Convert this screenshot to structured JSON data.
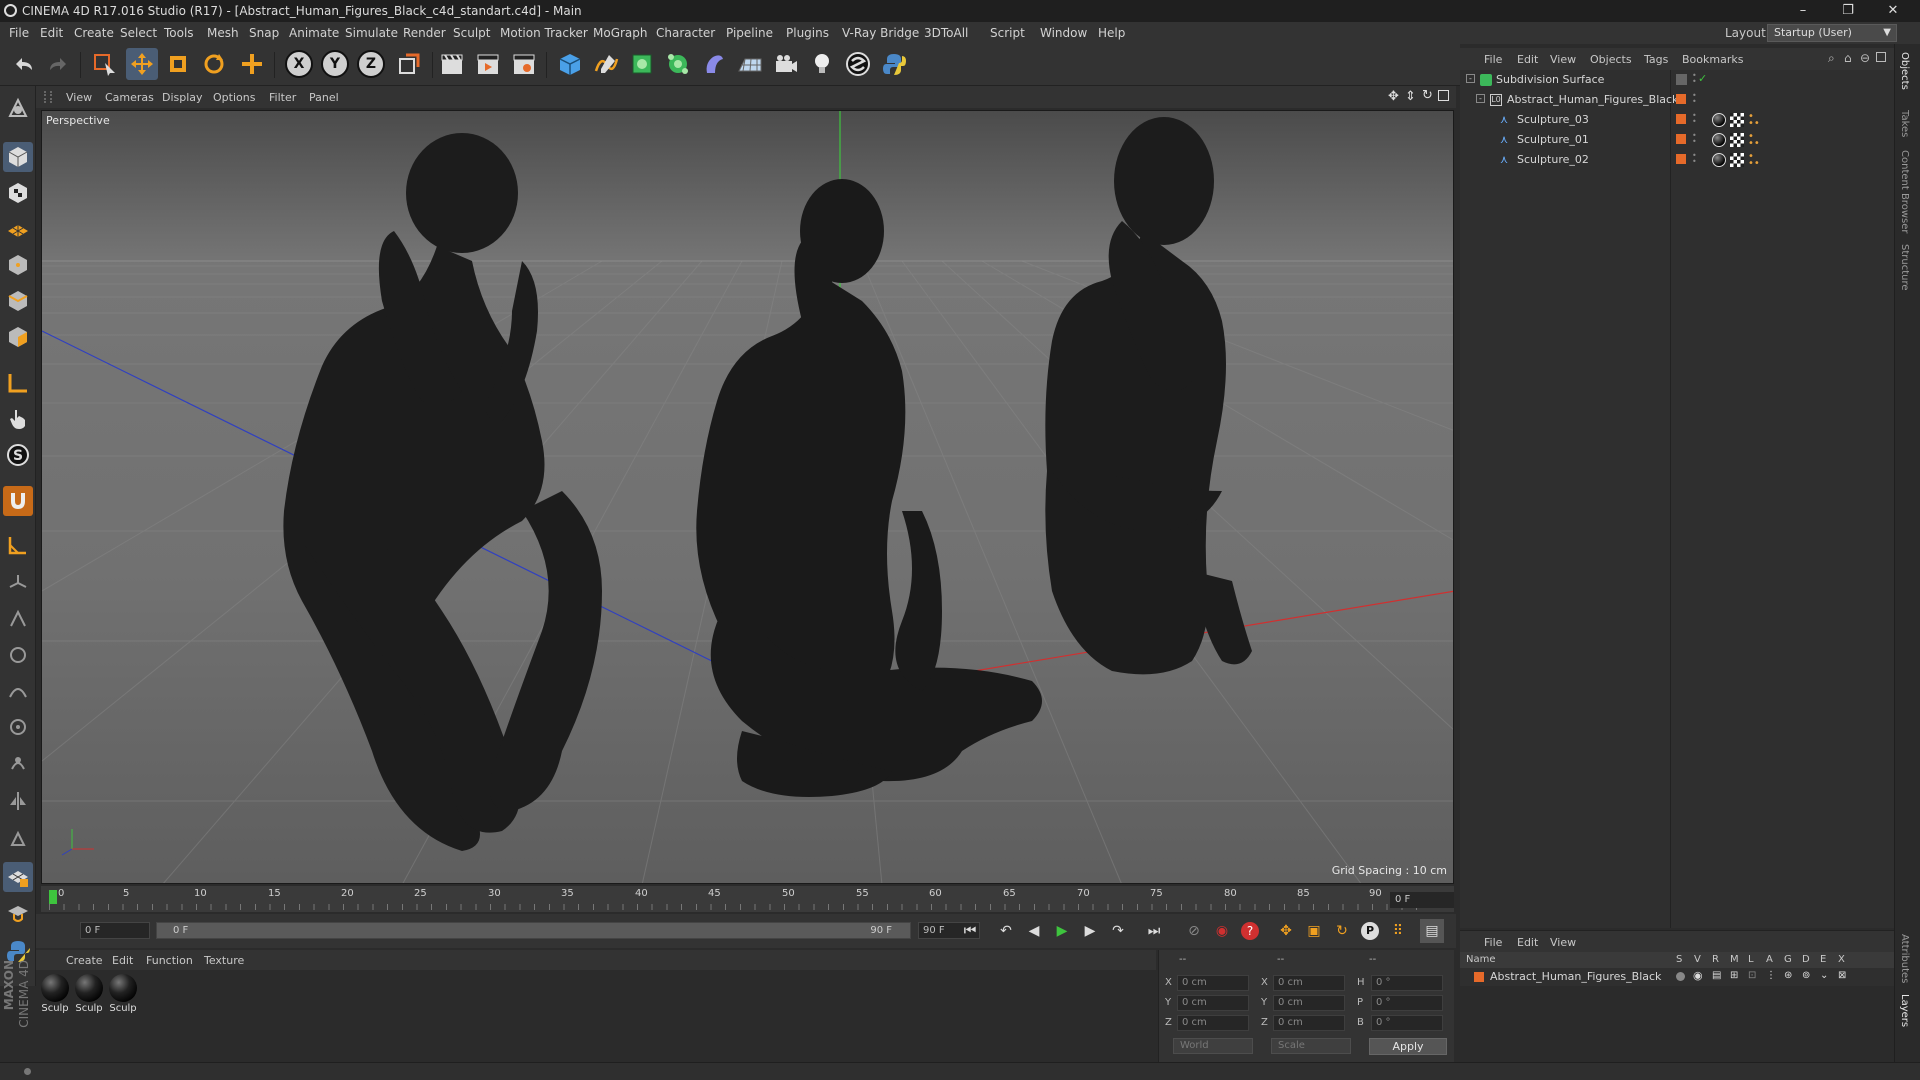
{
  "window": {
    "title": "CINEMA 4D R17.016 Studio (R17) - [Abstract_Human_Figures_Black_c4d_standart.c4d] - Main",
    "minimize": "–",
    "maximize": "❐",
    "close": "✕"
  },
  "menubar": {
    "items": [
      "File",
      "Edit",
      "Create",
      "Select",
      "Tools",
      "Mesh",
      "Snap",
      "Animate",
      "Simulate",
      "Render",
      "Sculpt",
      "Motion Tracker",
      "MoGraph",
      "Character",
      "Pipeline",
      "Plugins",
      "V-Ray Bridge",
      "3DToAll",
      "Script",
      "Window",
      "Help"
    ],
    "layout_label": "Layout:",
    "layout_value": "Startup (User)"
  },
  "toolbar": {
    "axis_x": "X",
    "axis_y": "Y",
    "axis_z": "Z"
  },
  "viewport": {
    "menu": [
      "View",
      "Cameras",
      "Display",
      "Options",
      "Filter",
      "Panel"
    ],
    "label": "Perspective",
    "grid_spacing": "Grid Spacing : 10 cm"
  },
  "timeline": {
    "ticks": [
      "0",
      "5",
      "10",
      "15",
      "20",
      "25",
      "30",
      "35",
      "40",
      "45",
      "50",
      "55",
      "60",
      "65",
      "70",
      "75",
      "80",
      "85",
      "90"
    ],
    "current_frame": "0 F",
    "start_field": "0 F",
    "range_start": "0 F",
    "range_end": "90 F",
    "end_field": "90 F"
  },
  "material_manager": {
    "menu": [
      "Create",
      "Edit",
      "Function",
      "Texture"
    ],
    "materials": [
      "Sculp",
      "Sculp",
      "Sculp"
    ]
  },
  "coordinates": {
    "header_a": "--",
    "header_b": "--",
    "header_c": "--",
    "rows": [
      {
        "pos_label": "X",
        "pos_value": "0 cm",
        "size_label": "X",
        "size_value": "0 cm",
        "rot_label": "H",
        "rot_value": "0 °"
      },
      {
        "pos_label": "Y",
        "pos_value": "0 cm",
        "size_label": "Y",
        "size_value": "0 cm",
        "rot_label": "P",
        "rot_value": "0 °"
      },
      {
        "pos_label": "Z",
        "pos_value": "0 cm",
        "size_label": "Z",
        "size_value": "0 cm",
        "rot_label": "B",
        "rot_value": "0 °"
      }
    ],
    "coord_system": "World",
    "mode": "Scale",
    "apply_label": "Apply"
  },
  "object_manager": {
    "menu": [
      "File",
      "Edit",
      "View",
      "Objects",
      "Tags",
      "Bookmarks"
    ],
    "objects": [
      {
        "name": "Subdivision Surface"
      },
      {
        "name": "Abstract_Human_Figures_Black"
      },
      {
        "name": "Sculpture_03"
      },
      {
        "name": "Sculpture_01"
      },
      {
        "name": "Sculpture_02"
      }
    ]
  },
  "layer_manager": {
    "menu": [
      "File",
      "Edit",
      "View"
    ],
    "columns": [
      "Name",
      "S",
      "V",
      "R",
      "M",
      "L",
      "A",
      "G",
      "D",
      "E",
      "X"
    ],
    "layer_name": "Abstract_Human_Figures_Black"
  },
  "side_tabs": [
    "Objects",
    "Takes",
    "Content Browser",
    "Structure",
    "Attributes",
    "Layers"
  ],
  "branding": {
    "maxon": "MAXON",
    "cinema": "CINEMA 4D"
  },
  "colors": {
    "layer_orange": "#e66a2a",
    "accent_blue": "#3c8dd8",
    "axis_green": "#3ec43e",
    "axis_red": "#d03030",
    "axis_blue": "#3040c0"
  }
}
